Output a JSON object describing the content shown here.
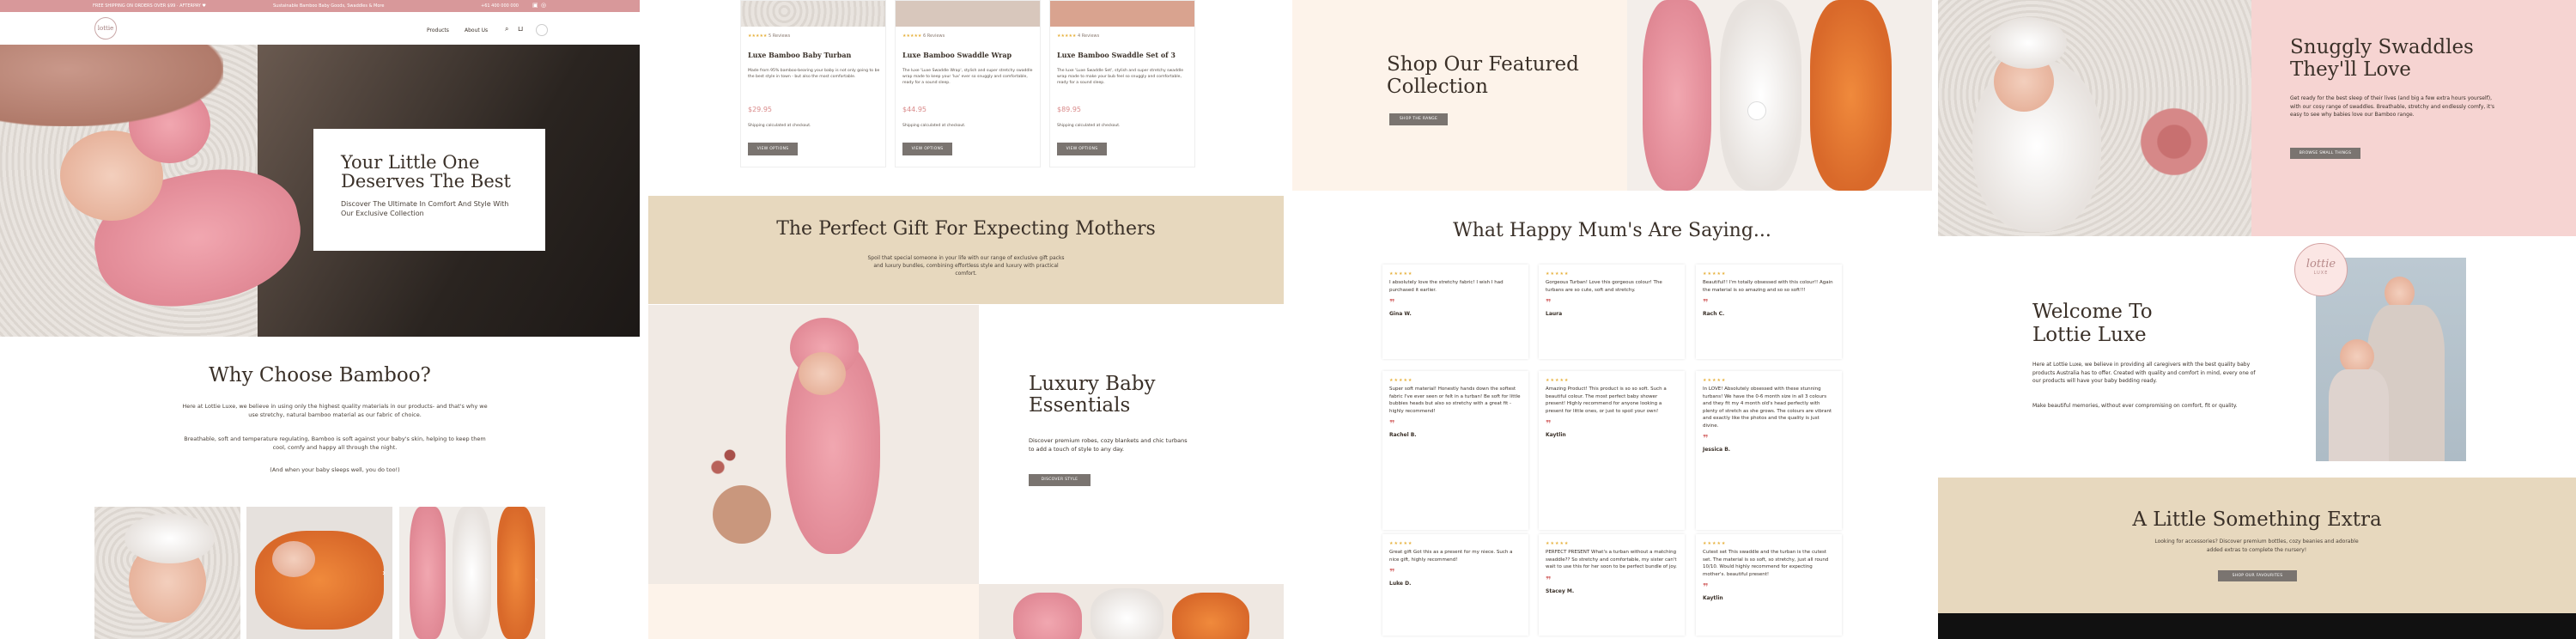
{
  "p1": {
    "topbar": {
      "left": "FREE SHIPPING ON ORDERS OVER $99 · AFTERPAY ♥",
      "mid": "Sustainable Bamboo Baby Goods, Swaddles & More",
      "phone": "+61 400 000 000"
    },
    "logo_text": "lottie",
    "nav": {
      "products": "Products",
      "about": "About Us"
    },
    "hero": {
      "title": "Your Little One Deserves The Best",
      "subtitle": "Discover The Ultimate In Comfort And Style With Our Exclusive Collection"
    },
    "why": {
      "title": "Why Choose Bamboo?",
      "p1": "Here at Lottie Luxe, we believe in using only the highest quality materials in our products- and that's why we use stretchy, natural bamboo material as our fabric of choice.",
      "p2": "Breathable, soft and temperature regulating, Bamboo is soft against your baby's skin, helping to keep them cool, comfy and happy all through the night.",
      "p3": "(And when your baby sleeps well, you do too!)"
    }
  },
  "p2": {
    "products": [
      {
        "reviews": "5 Reviews",
        "name": "Luxe Bamboo Baby Turban",
        "desc": "Made from 95% bamboo-bearing your baby is not only going to be the best style in town - but also the most comfortable.",
        "price": "$29.95",
        "afterpay": "Shipping calculated at checkout.",
        "button": "VIEW OPTIONS"
      },
      {
        "reviews": "6 Reviews",
        "name": "Luxe Bamboo Swaddle Wrap",
        "desc": "The luxe 'Luxe Swaddle Wrap', stylish and super stretchy swaddle wrap made to keep your 'lux' ever so snuggly and comfortable, ready for a sound sleep.",
        "price": "$44.95",
        "afterpay": "Shipping calculated at checkout.",
        "button": "VIEW OPTIONS"
      },
      {
        "reviews": "4 Reviews",
        "name": "Luxe Bamboo Swaddle Set of 3",
        "desc": "The luxe 'Luxe Swaddle Set', stylish and super stretchy swaddle wrap made to make your bub feel so snuggly and comfortable, ready for a sound sleep.",
        "price": "$89.95",
        "afterpay": "Shipping calculated at checkout.",
        "button": "VIEW OPTIONS"
      }
    ],
    "gift": {
      "title": "The Perfect Gift For Expecting Mothers",
      "text": "Spoil that special someone in your life with our range of exclusive gift packs and luxury bundles, combining effortless style and luxury with practical comfort."
    },
    "essentials": {
      "title": "Luxury Baby Essentials",
      "text": "Discover premium robes, cozy blankets and chic turbans to add a touch of style to any day.",
      "button": "DISCOVER STYLE"
    }
  },
  "p3": {
    "featured": {
      "title": "Shop Our Featured Collection",
      "button": "SHOP THE RANGE"
    },
    "reviews_title": "What Happy Mum's Are Saying...",
    "reviews": [
      {
        "text": "I absolutely love the stretchy fabric! I wish I had purchased it earlier.",
        "name": "Gina W."
      },
      {
        "text": "Gorgeous Turban! Love this gorgeous colour! The turbans are so cute, soft and stretchy.",
        "name": "Laura"
      },
      {
        "text": "Beautiful!! I'm totally obsessed with this colour!! Again the material is so amazing and so so soft!!!",
        "name": "Rach C."
      },
      {
        "text": "Super soft material! Honestly hands down the softest fabric I've ever seen or felt in a turban! Be soft for little bubbies heads but also so stretchy with a great fit - highly recommend!",
        "name": "Rachel B."
      },
      {
        "text": "Amazing Product! This product is so so soft. Such a beautiful colour. The most perfect baby shower present! Highly recommend for anyone looking a present for little ones, or just to spoil your own!",
        "name": "Kaytlin"
      },
      {
        "text": "In LOVE! Absolutely obsessed with these stunning turbans! We have the 0-6 month size in all 3 colours and they fit my 4 month old's head perfectly with plenty of stretch as she grows. The colours are vibrant and exactly like the photos and the quality is just divine.",
        "name": "Jessica B."
      },
      {
        "text": "Great gift Got this as a present for my niece. Such a nice gift, highly recommend!",
        "name": "Luke D."
      },
      {
        "text": "PERFECT PRESENT What's a turban without a matching swaddle?? So stretchy and comfortable, my sister can't wait to use this for her soon to be perfect bundle of joy.",
        "name": "Stacey M."
      },
      {
        "text": "Cutest set This swaddle and the turban is the cutest set. The material is so soft, so stretchy, just all round 10/10. Would highly recommend for expecting mother's. beautiful present!",
        "name": "Kaytlin"
      }
    ]
  },
  "p4": {
    "snuggly": {
      "title": "Snuggly Swaddles They'll Love",
      "text": "Get ready for the best sleep of their lives (and big a few extra hours yourself), with our cosy range of swaddles. Breathable, stretchy and endlessly comfy, it's easy to see why babies love our Bamboo range.",
      "button": "BROWSE SMALL THINGS"
    },
    "welcome": {
      "title": "Welcome To Lottie Luxe",
      "p1": "Here at Lottie Luxe, we believe in providing all caregivers with the best quality baby products Australia has to offer. Created with quality and comfort in mind, every one of our products will have your baby bedding ready.",
      "p2": "Make beautiful memories, without ever compromising on comfort, fit or quality."
    },
    "logo_text": "lottie",
    "logo_sub": "LUXE",
    "extra": {
      "title": "A Little Something Extra",
      "text": "Looking for accessories? Discover premium bottles, cozy beanies and adorable added extras to complete the nursery!",
      "button": "SHOP OUR FAVOURITES"
    }
  },
  "colors": {
    "pink": "#d8989a",
    "cream": "#e7d8be",
    "blush": "#f6d4d2",
    "text": "#3a3028"
  }
}
